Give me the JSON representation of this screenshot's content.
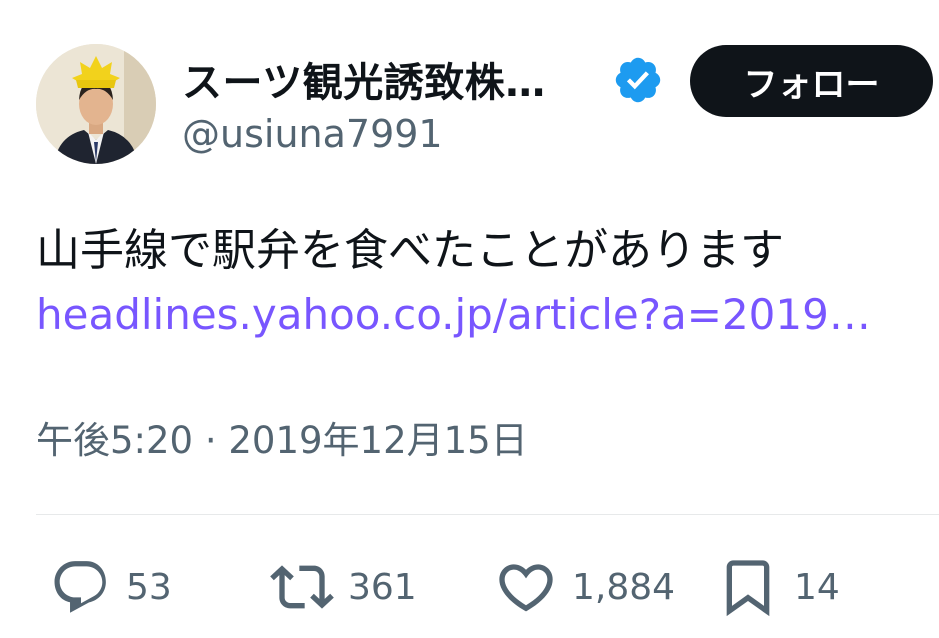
{
  "author": {
    "display_name": "スーツ観光誘致株…",
    "handle": "@usiuna7991",
    "verified": true
  },
  "follow_button_label": "フォロー",
  "tweet": {
    "text": "山手線で駅弁を食べたことがあります",
    "link_text": "headlines.yahoo.co.jp/article?a=2019…",
    "timestamp": "午後5:20 · 2019年12月15日"
  },
  "actions": {
    "replies": "53",
    "retweets": "361",
    "likes": "1,884",
    "bookmarks": "14"
  },
  "colors": {
    "text": "#0f1419",
    "muted": "#536471",
    "link": "#7856ff",
    "verified": "#1d9bf0",
    "button_bg": "#0f1419",
    "divider": "#e7e9ea"
  }
}
